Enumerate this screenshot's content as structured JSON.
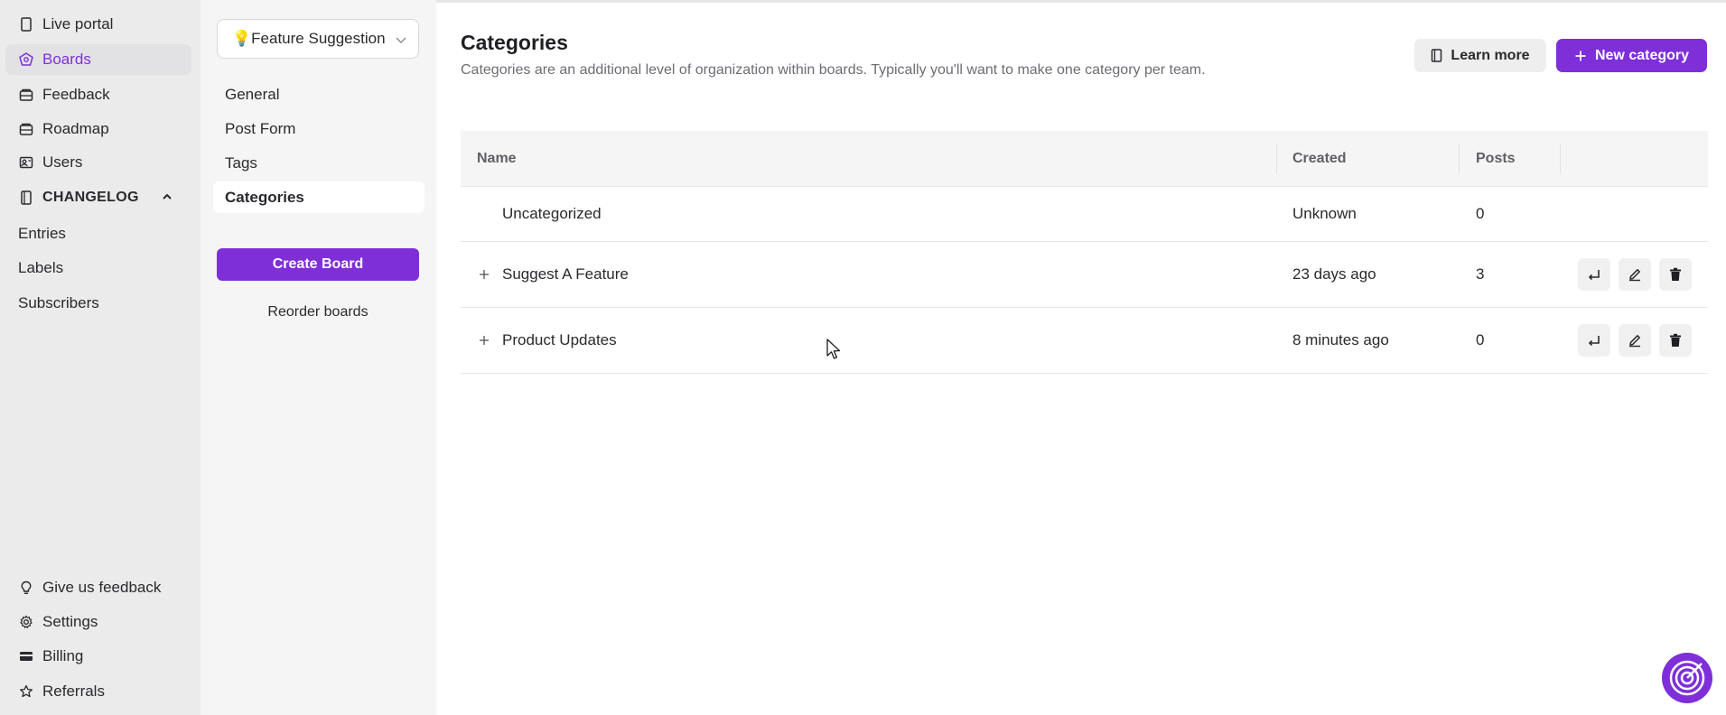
{
  "nav": {
    "items": [
      {
        "label": "Live portal",
        "icon": "live-portal-icon"
      },
      {
        "label": "Boards",
        "icon": "boards-icon",
        "active": true
      },
      {
        "label": "Feedback",
        "icon": "feedback-icon"
      },
      {
        "label": "Roadmap",
        "icon": "roadmap-icon"
      },
      {
        "label": "Users",
        "icon": "users-icon"
      }
    ],
    "changelog": {
      "label": "CHANGELOG",
      "items": [
        {
          "label": "Entries"
        },
        {
          "label": "Labels"
        },
        {
          "label": "Subscribers"
        }
      ]
    },
    "bottom": [
      {
        "label": "Give us feedback",
        "icon": "lightbulb-icon"
      },
      {
        "label": "Settings",
        "icon": "gear-icon"
      },
      {
        "label": "Billing",
        "icon": "credit-card-icon"
      },
      {
        "label": "Referrals",
        "icon": "star-icon"
      }
    ]
  },
  "board_settings": {
    "selected_board": "💡Feature Suggestion",
    "items": [
      {
        "label": "General"
      },
      {
        "label": "Post Form"
      },
      {
        "label": "Tags"
      },
      {
        "label": "Categories",
        "active": true
      }
    ],
    "create_label": "Create Board",
    "reorder_label": "Reorder boards"
  },
  "main": {
    "title": "Categories",
    "description": "Categories are an additional level of organization within boards. Typically you'll want to make one category per team.",
    "learn_more_label": "Learn more",
    "new_category_label": "New category",
    "table": {
      "headers": {
        "name": "Name",
        "created": "Created",
        "posts": "Posts"
      },
      "rows": [
        {
          "name": "Uncategorized",
          "created": "Unknown",
          "posts": "0"
        },
        {
          "name": "Suggest A Feature",
          "created": "23 days ago",
          "posts": "3"
        },
        {
          "name": "Product Updates",
          "created": "8 minutes ago",
          "posts": "0"
        }
      ]
    }
  },
  "colors": {
    "accent": "#7e2fd8",
    "nav_bg": "#ebebeb",
    "sub_nav_bg": "#f5f5f5"
  }
}
